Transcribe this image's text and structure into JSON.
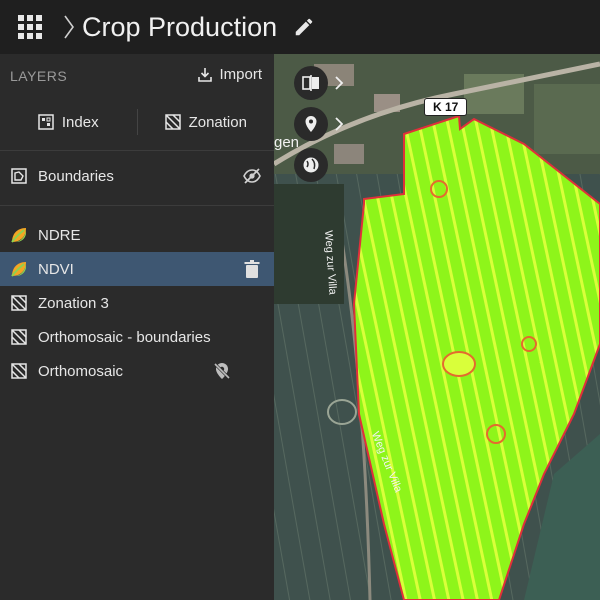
{
  "header": {
    "title": "Crop Production",
    "apps_icon": "apps-grid-icon",
    "edit_icon": "pencil-icon"
  },
  "sidebar": {
    "heading": "LAYERS",
    "import_label": "Import",
    "tabs": [
      {
        "label": "Index",
        "icon": "index-icon"
      },
      {
        "label": "Zonation",
        "icon": "zonation-icon"
      }
    ],
    "boundaries_label": "Boundaries",
    "layers": [
      {
        "label": "NDRE",
        "icon": "leaf-icon",
        "selected": false
      },
      {
        "label": "NDVI",
        "icon": "leaf-icon",
        "selected": true
      },
      {
        "label": "Zonation 3",
        "icon": "zonation-icon",
        "selected": false
      },
      {
        "label": "Orthomosaic - boundaries",
        "icon": "zonation-icon",
        "selected": false
      },
      {
        "label": "Orthomosaic",
        "icon": "zonation-icon",
        "selected": false
      }
    ]
  },
  "map": {
    "road_label": "K 17",
    "street_label_1": "Weg zur Villa",
    "street_label_2": "Weg zur Villa",
    "place_label_fragment": "gen",
    "field_color": "#9cff1a",
    "accent_color": "#3e5772"
  }
}
